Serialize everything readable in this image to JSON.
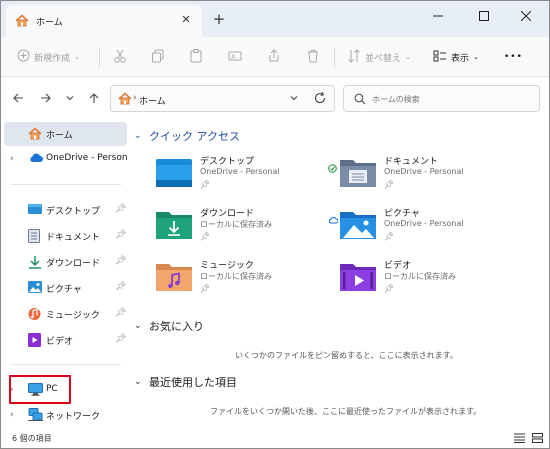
{
  "window": {
    "tab_title": "ホーム",
    "new_tab": "+",
    "tab_close": "✕"
  },
  "toolbar": {
    "new_label": "新規作成",
    "sort_label": "並べ替え",
    "view_label": "表示",
    "more_label": "•••"
  },
  "address": {
    "crumb": "ホーム",
    "separator": "›",
    "search_placeholder": "ホームの検索"
  },
  "nav": {
    "home": "ホーム",
    "onedrive": "OneDrive - Personal",
    "desktop": "デスクトップ",
    "documents": "ドキュメント",
    "downloads": "ダウンロード",
    "pictures": "ピクチャ",
    "music": "ミュージック",
    "videos": "ビデオ",
    "pc": "PC",
    "network": "ネットワーク"
  },
  "content": {
    "quick_access": "クイック アクセス",
    "favorites": "お気に入り",
    "favorites_empty": "いくつかのファイルをピン留めすると、ここに表示されます。",
    "recent": "最近使用した項目",
    "recent_empty": "ファイルをいくつか開いた後、ここに最近使ったファイルが表示されます。",
    "items": [
      {
        "name": "デスクトップ",
        "sub": "OneDrive - Personal"
      },
      {
        "name": "ドキュメント",
        "sub": "OneDrive - Personal"
      },
      {
        "name": "ダウンロード",
        "sub": "ローカルに保存済み"
      },
      {
        "name": "ピクチャ",
        "sub": "OneDrive - Personal"
      },
      {
        "name": "ミュージック",
        "sub": "ローカルに保存済み"
      },
      {
        "name": "ビデオ",
        "sub": "ローカルに保存済み"
      }
    ]
  },
  "status": {
    "item_count": "6 個の項目"
  },
  "colors": {
    "accent": "#1f4e9c",
    "highlight_box": "#e0001a",
    "selected_bg": "#e0e6ee"
  }
}
